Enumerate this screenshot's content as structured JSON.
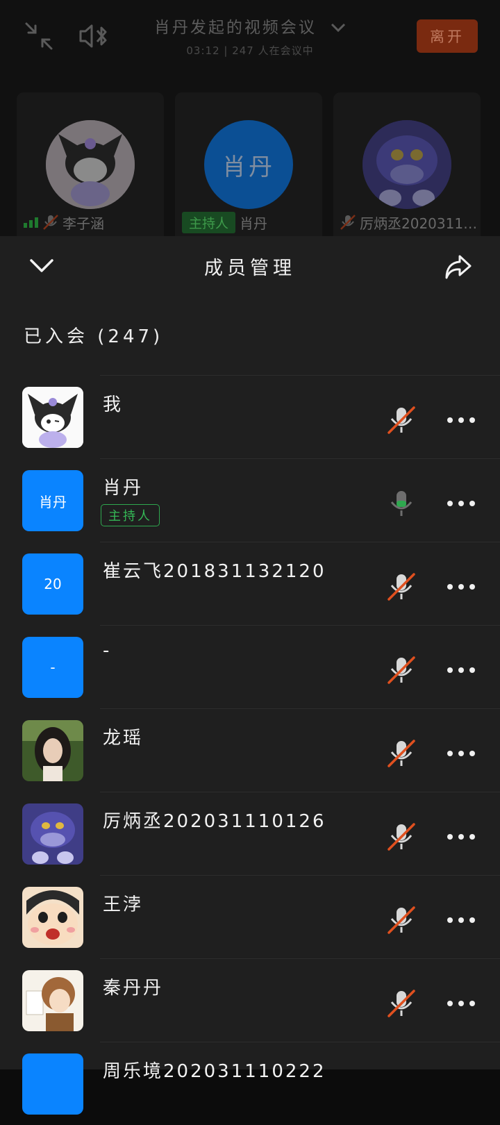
{
  "meeting": {
    "title": "肖丹发起的视频会议",
    "subtitle": "03:12 | 247 人在会议中",
    "leave_label": "离开",
    "tiles": [
      {
        "name": "李子涵",
        "host_label": ""
      },
      {
        "name": "肖丹",
        "host_label": "主持人",
        "avatar_text": "肖丹"
      },
      {
        "name": "厉炳丞2020311…",
        "host_label": ""
      }
    ]
  },
  "panel": {
    "title": "成员管理",
    "section_label": "已入会 (247)"
  },
  "members": [
    {
      "name": "我",
      "avatar_text": "",
      "avatar_style": "kuromi",
      "mic": "muted"
    },
    {
      "name": "肖丹",
      "avatar_text": "肖丹",
      "avatar_style": "blue",
      "mic": "on",
      "tag": "主持人"
    },
    {
      "name": "崔云飞201831132120",
      "avatar_text": "20",
      "avatar_style": "blue",
      "mic": "muted"
    },
    {
      "name": "-",
      "avatar_text": "-",
      "avatar_style": "blue",
      "mic": "muted"
    },
    {
      "name": "龙瑶",
      "avatar_text": "",
      "avatar_style": "photo-girl",
      "mic": "muted"
    },
    {
      "name": "厉炳丞202031110126",
      "avatar_text": "",
      "avatar_style": "tom-cat",
      "mic": "muted"
    },
    {
      "name": "王浡",
      "avatar_text": "",
      "avatar_style": "shinchan",
      "mic": "muted"
    },
    {
      "name": "秦丹丹",
      "avatar_text": "",
      "avatar_style": "anime-girl",
      "mic": "muted"
    },
    {
      "name": "周乐境202031110222",
      "avatar_text": "",
      "avatar_style": "blue",
      "mic": "muted"
    }
  ],
  "colors": {
    "muted_slash": "#e0501f",
    "mic_on_green": "#2fa84f",
    "avatar_blue": "#0a84ff",
    "panel_bg": "#1f1f1f"
  }
}
